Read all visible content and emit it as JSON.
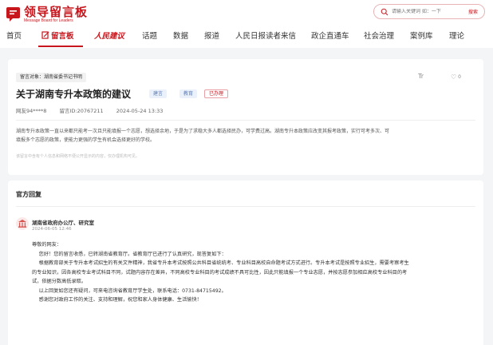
{
  "header": {
    "logo_title": "领导留言板",
    "logo_subtitle": "Message Board for Leaders",
    "search_placeholder": "请输入关键词 如：一下",
    "search_button": "搜索"
  },
  "nav": {
    "items": [
      "首页",
      "留言板",
      "人民建议",
      "话题",
      "数据",
      "报道",
      "人民日报读者来信",
      "政企直通车",
      "社会治理",
      "案例库",
      "理论"
    ]
  },
  "post": {
    "target_label": "留言对象：湖南省委书记书明",
    "font_icon": "Tr",
    "like_count": "0",
    "title": "关于湖南专升本政策的建议",
    "badges": [
      "建言",
      "教育",
      "已办理"
    ],
    "author": "网友94****8",
    "message_id": "留言ID:20767211",
    "date": "2024-05-24 13:33",
    "content_lines": [
      "湖南专升本政策一直以来都只能考一次且只能填报一个志愿，想选择余地，于是为了求稳大多人都选择民办，可学费过高。湖南专升本政策应改变其报考政策，实行可考多次、可",
      "填报多个志愿的政策，使能力更强的学生有机会选择更好的学校。"
    ],
    "note": "该留言中含有个人信息和网络不便公开显示的内容，仅办理机构可见。"
  },
  "reply": {
    "heading": "官方回复",
    "agency": "湖南省政府办公厅、研究室",
    "time": "2024-06-05 12:46",
    "greeting": "尊敬的网友：",
    "paragraphs": [
      "您好！您的留言收悉，已转湖南省教育厅。省教育厅已进行了认真研究，现答复如下：",
      "根据教育部关于专升本考试招生的有关文件精神，我省专升本考试按照公共科目省统统考、专业科目高校自命题考试方式进行。专升本考试是按照专业招生，需要考察考生",
      "的专业知识，因各高校专业考试科目不同，试题内容存在差异，不同高校专业科目的考试成绩不具可比性，因此只能填报一个专业志愿，并按志愿参加相应高校专业科目的考",
      "试，依据分数高低录取。",
      "以上回复如您还有疑问，可来电咨询省教育厅学生处，联系电话：0731-84715492。",
      "感谢您对政府工作的关注、支持和理解，祝您和家人身体健康、生活愉快！"
    ]
  },
  "colors": {
    "accent": "#c8161d",
    "badge_blue_bg": "#eaf1fb",
    "badge_blue_text": "#5b7db8"
  }
}
